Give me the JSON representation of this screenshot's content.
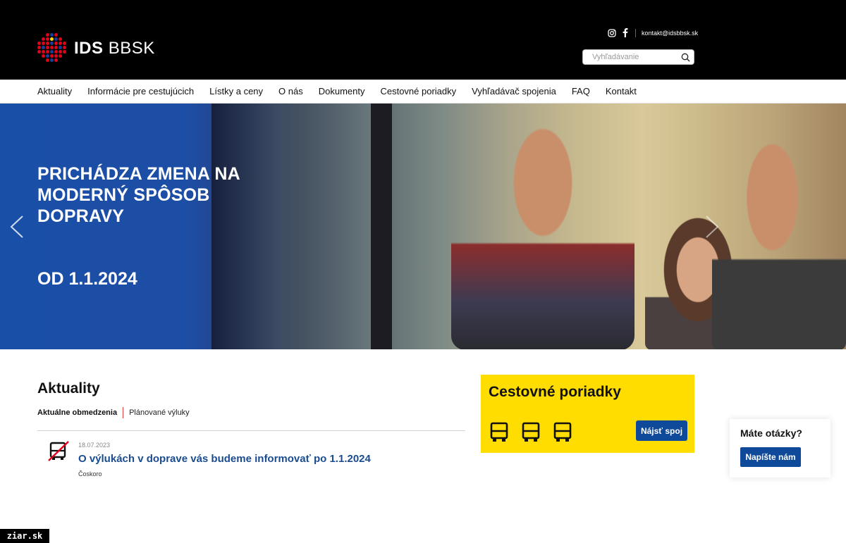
{
  "header": {
    "logo_bold": "IDS",
    "logo_regular": "BBSK",
    "email": "kontakt@idsbbsk.sk",
    "search_placeholder": "Vyhľadávanie",
    "social_icons": [
      "instagram-icon",
      "facebook-icon"
    ],
    "logo_colors": [
      "#e3001b",
      "#1a3ea0",
      "#ffdd00"
    ]
  },
  "nav": {
    "items": [
      "Aktuality",
      "Informácie pre cestujúcich",
      "Lístky a ceny",
      "O nás",
      "Dokumenty",
      "Cestovné poriadky",
      "Vyhľadávač spojenia",
      "FAQ",
      "Kontakt"
    ]
  },
  "hero": {
    "headline": "PRICHÁDZA ZMENA NA MODERNÝ SPÔSOB DOPRAVY",
    "date": "OD 1.1.2024"
  },
  "news": {
    "title": "Aktuality",
    "tabs": [
      "Aktuálne obmedzenia",
      "Plánované výluky"
    ],
    "items": [
      {
        "date": "18.07.2023",
        "headline": "O výlukách v doprave vás budeme informovať po 1.1.2024",
        "sub": "Čoskoro"
      }
    ]
  },
  "timetables": {
    "title": "Cestovné poriadky",
    "button": "Nájsť spoj",
    "accent": "#ffdd00",
    "button_color": "#0f4a9a"
  },
  "questions": {
    "title": "Máte otázky?",
    "button": "Napíšte nám"
  },
  "watermark": "ziar.sk"
}
